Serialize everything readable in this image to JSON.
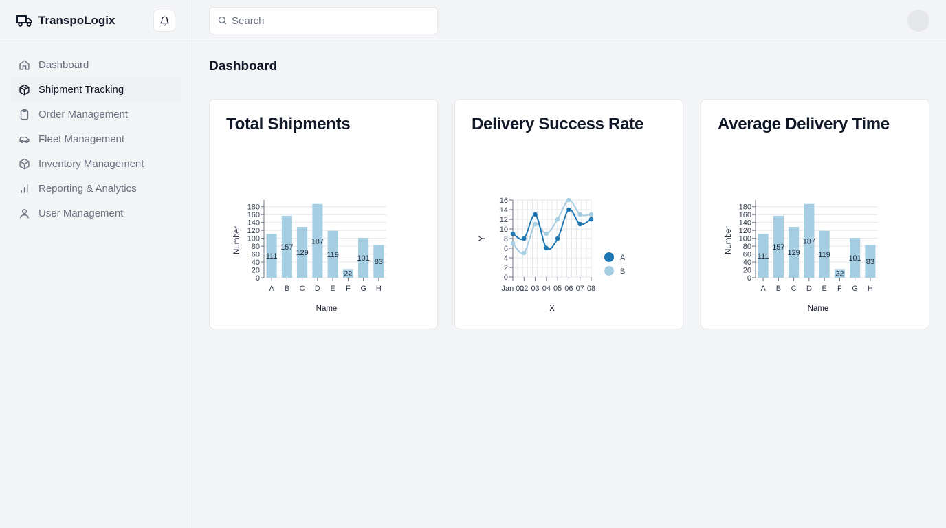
{
  "app": {
    "name": "TranspoLogix"
  },
  "search": {
    "placeholder": "Search"
  },
  "sidebar": {
    "items": [
      {
        "label": "Dashboard",
        "icon": "home-icon",
        "active": false
      },
      {
        "label": "Shipment Tracking",
        "icon": "package-icon",
        "active": true
      },
      {
        "label": "Order Management",
        "icon": "clipboard-icon",
        "active": false
      },
      {
        "label": "Fleet Management",
        "icon": "car-icon",
        "active": false
      },
      {
        "label": "Inventory Management",
        "icon": "box-icon",
        "active": false
      },
      {
        "label": "Reporting & Analytics",
        "icon": "bar-chart-icon",
        "active": false
      },
      {
        "label": "User Management",
        "icon": "user-icon",
        "active": false
      }
    ]
  },
  "page": {
    "title": "Dashboard"
  },
  "cards": [
    {
      "title": "Total Shipments"
    },
    {
      "title": "Delivery Success Rate"
    },
    {
      "title": "Average Delivery Time"
    }
  ],
  "colors": {
    "bar": "#a6cee3",
    "series_a": "#1f78b4",
    "series_b": "#a6cee3"
  },
  "chart_data": [
    {
      "type": "bar",
      "categories": [
        "A",
        "B",
        "C",
        "D",
        "E",
        "F",
        "G",
        "H"
      ],
      "values": [
        111,
        157,
        129,
        187,
        119,
        22,
        101,
        83
      ],
      "title": "",
      "xlabel": "Name",
      "ylabel": "Number",
      "yticks": [
        0,
        20,
        40,
        60,
        80,
        100,
        120,
        140,
        160,
        180
      ],
      "ylim": [
        0,
        190
      ],
      "grid": true
    },
    {
      "type": "line",
      "x": [
        "Jan 01",
        "02",
        "03",
        "04",
        "05",
        "06",
        "07",
        "08"
      ],
      "series": [
        {
          "name": "A",
          "values": [
            9,
            8,
            13,
            6,
            8,
            14,
            11,
            12
          ]
        },
        {
          "name": "B",
          "values": [
            7,
            5,
            11,
            9,
            12,
            16,
            13,
            13
          ]
        }
      ],
      "xlabel": "X",
      "ylabel": "Y",
      "yticks": [
        0,
        2,
        4,
        6,
        8,
        10,
        12,
        14,
        16
      ],
      "ylim": [
        0,
        16
      ],
      "grid": true,
      "legend": "right"
    },
    {
      "type": "bar",
      "categories": [
        "A",
        "B",
        "C",
        "D",
        "E",
        "F",
        "G",
        "H"
      ],
      "values": [
        111,
        157,
        129,
        187,
        119,
        22,
        101,
        83
      ],
      "title": "",
      "xlabel": "Name",
      "ylabel": "Number",
      "yticks": [
        0,
        20,
        40,
        60,
        80,
        100,
        120,
        140,
        160,
        180
      ],
      "ylim": [
        0,
        190
      ],
      "grid": true
    }
  ]
}
